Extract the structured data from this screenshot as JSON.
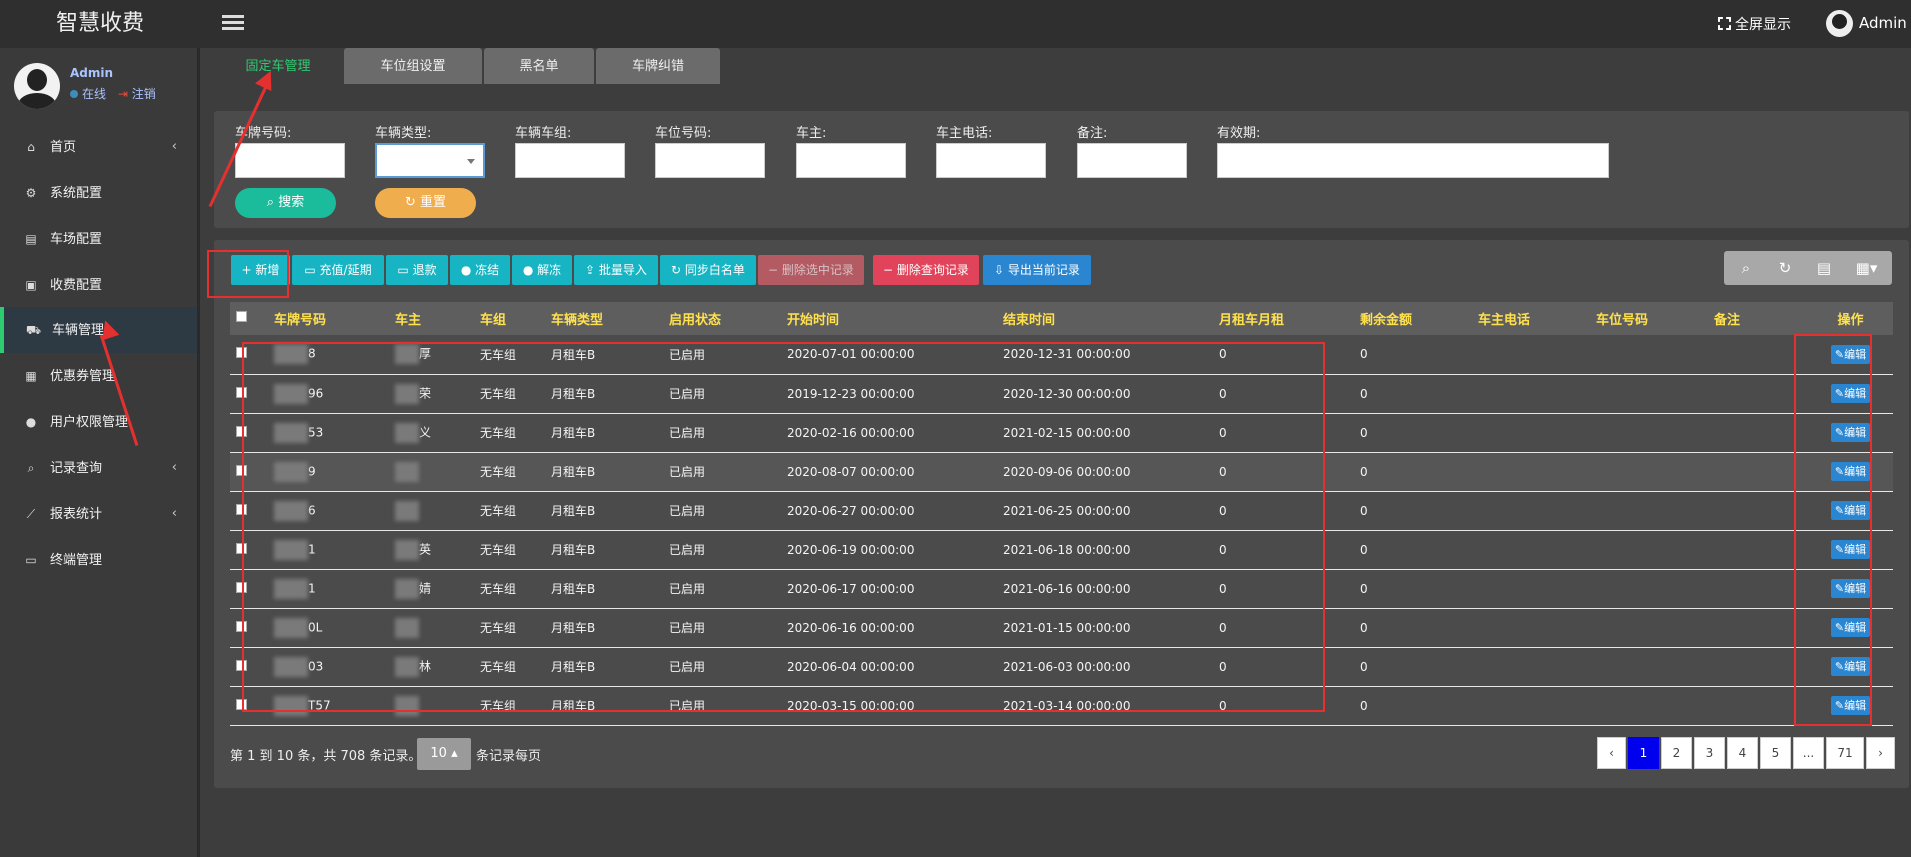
{
  "app": {
    "title": "智慧收费"
  },
  "header": {
    "fullscreen_label": "全屏显示",
    "user_label": "Admin"
  },
  "sidebar": {
    "user": {
      "name": "Admin",
      "status_online": "在线",
      "logout": "注销"
    },
    "items": [
      {
        "label": "首页",
        "icon": "home-icon",
        "has_arrow": true
      },
      {
        "label": "系统配置",
        "icon": "gears-icon"
      },
      {
        "label": "车场配置",
        "icon": "file-icon"
      },
      {
        "label": "收费配置",
        "icon": "money-icon"
      },
      {
        "label": "车辆管理",
        "icon": "car-icon",
        "active": true
      },
      {
        "label": "优惠券管理",
        "icon": "calendar-icon"
      },
      {
        "label": "用户权限管理",
        "icon": "user-icon"
      },
      {
        "label": "记录查询",
        "icon": "search-icon",
        "has_arrow": true
      },
      {
        "label": "报表统计",
        "icon": "chart-icon",
        "has_arrow": true
      },
      {
        "label": "终端管理",
        "icon": "monitor-icon"
      }
    ]
  },
  "tabs": [
    {
      "label": "固定车管理",
      "active": true
    },
    {
      "label": "车位组设置"
    },
    {
      "label": "黑名单"
    },
    {
      "label": "车牌纠错"
    }
  ],
  "search": {
    "fields": [
      {
        "label": "车牌号码:",
        "value": ""
      },
      {
        "label": "车辆类型:",
        "value": ""
      },
      {
        "label": "车辆车组:",
        "value": ""
      },
      {
        "label": "车位号码:",
        "value": ""
      },
      {
        "label": "车主:",
        "value": ""
      },
      {
        "label": "车主电话:",
        "value": ""
      },
      {
        "label": "备注:",
        "value": ""
      },
      {
        "label": "有效期:",
        "value": ""
      }
    ],
    "search_button": "搜索",
    "reset_button": "重置"
  },
  "toolbar": {
    "add": "新增",
    "recharge": "充值/延期",
    "refund": "退款",
    "freeze": "冻结",
    "unfreeze": "解冻",
    "batch_import": "批量导入",
    "sync_whitelist": "同步白名单",
    "delete_selected": "删除选中记录",
    "delete_query": "删除查询记录",
    "export_current": "导出当前记录"
  },
  "colors": {
    "accent_green": "#2ecc71",
    "header_yellow": "#ffe14d",
    "search_btn": "#1abc9c",
    "reset_btn": "#f0ad4e",
    "annotation_red": "#e53030"
  },
  "table": {
    "columns": [
      "车牌号码",
      "车主",
      "车组",
      "车辆类型",
      "启用状态",
      "开始时间",
      "结束时间",
      "月租车月租",
      "剩余金额",
      "车主电话",
      "车位号码",
      "备注",
      "操作"
    ],
    "edit_label": "编辑",
    "rows": [
      {
        "plate": "8",
        "owner": "厚",
        "group": "无车组",
        "type": "月租车B",
        "status": "已启用",
        "start": "2020-07-01 00:00:00",
        "end": "2020-12-31 00:00:00",
        "monthly": "0",
        "balance": "0"
      },
      {
        "plate": "96",
        "owner": "荣",
        "group": "无车组",
        "type": "月租车B",
        "status": "已启用",
        "start": "2019-12-23 00:00:00",
        "end": "2020-12-30 00:00:00",
        "monthly": "0",
        "balance": "0"
      },
      {
        "plate": "53",
        "owner": "义",
        "group": "无车组",
        "type": "月租车B",
        "status": "已启用",
        "start": "2020-02-16 00:00:00",
        "end": "2021-02-15 00:00:00",
        "monthly": "0",
        "balance": "0"
      },
      {
        "plate": "9",
        "owner": "",
        "group": "无车组",
        "type": "月租车B",
        "status": "已启用",
        "start": "2020-08-07 00:00:00",
        "end": "2020-09-06 00:00:00",
        "monthly": "0",
        "balance": "0"
      },
      {
        "plate": "6",
        "owner": "",
        "group": "无车组",
        "type": "月租车B",
        "status": "已启用",
        "start": "2020-06-27 00:00:00",
        "end": "2021-06-25 00:00:00",
        "monthly": "0",
        "balance": "0"
      },
      {
        "plate": "1",
        "owner": "英",
        "group": "无车组",
        "type": "月租车B",
        "status": "已启用",
        "start": "2020-06-19 00:00:00",
        "end": "2021-06-18 00:00:00",
        "monthly": "0",
        "balance": "0"
      },
      {
        "plate": "1",
        "owner": "婧",
        "group": "无车组",
        "type": "月租车B",
        "status": "已启用",
        "start": "2020-06-17 00:00:00",
        "end": "2021-06-16 00:00:00",
        "monthly": "0",
        "balance": "0"
      },
      {
        "plate": "0L",
        "owner": "",
        "group": "无车组",
        "type": "月租车B",
        "status": "已启用",
        "start": "2020-06-16 00:00:00",
        "end": "2021-01-15 00:00:00",
        "monthly": "0",
        "balance": "0"
      },
      {
        "plate": "03",
        "owner": "林",
        "group": "无车组",
        "type": "月租车B",
        "status": "已启用",
        "start": "2020-06-04 00:00:00",
        "end": "2021-06-03 00:00:00",
        "monthly": "0",
        "balance": "0"
      },
      {
        "plate": "T57",
        "owner": "",
        "group": "无车组",
        "type": "月租车B",
        "status": "已启用",
        "start": "2020-03-15 00:00:00",
        "end": "2021-03-14 00:00:00",
        "monthly": "0",
        "balance": "0"
      }
    ]
  },
  "pagination": {
    "info": "第 1 到 10 条，共 708 条记录。",
    "page_size": "10",
    "page_size_suffix": "条记录每页",
    "prev": "‹",
    "pages": [
      "1",
      "2",
      "3",
      "4",
      "5",
      "...",
      "71"
    ],
    "next": "›",
    "current": "1"
  }
}
